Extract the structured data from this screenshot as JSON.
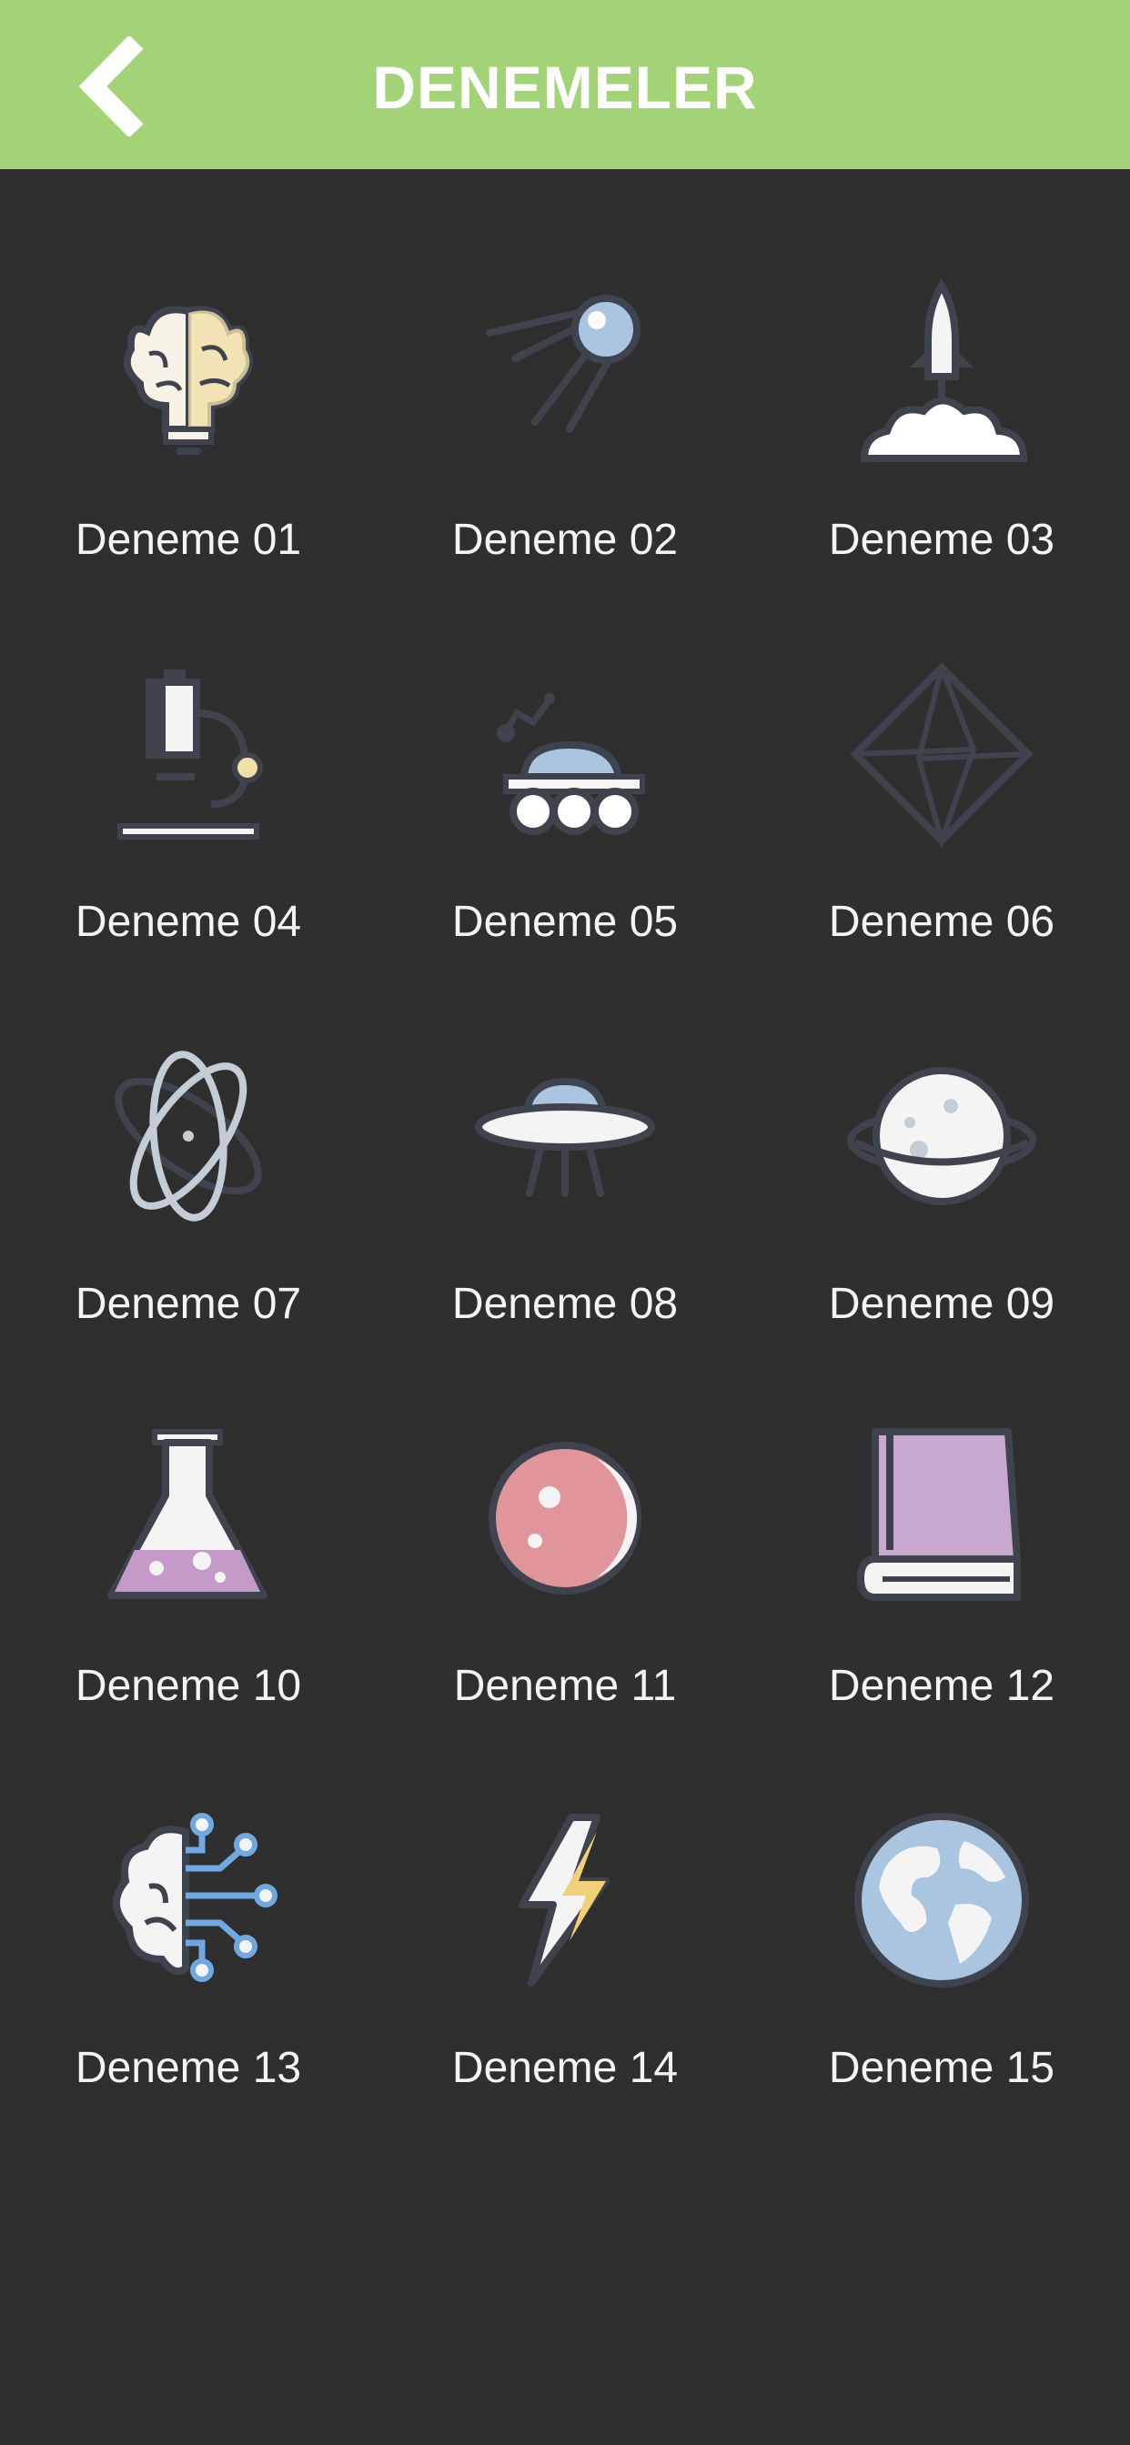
{
  "header": {
    "title": "DENEMELER",
    "back_icon": "chevron-left-icon"
  },
  "colors": {
    "header_bg": "#a3d377",
    "background": "#2f2f2f",
    "text": "#ffffff",
    "icon_outline": "#3f434d"
  },
  "items": [
    {
      "label": "Deneme 01",
      "icon": "brain-bulb-icon"
    },
    {
      "label": "Deneme 02",
      "icon": "satellite-icon"
    },
    {
      "label": "Deneme 03",
      "icon": "rocket-launch-icon"
    },
    {
      "label": "Deneme 04",
      "icon": "microscope-icon"
    },
    {
      "label": "Deneme 05",
      "icon": "moon-rover-icon"
    },
    {
      "label": "Deneme 06",
      "icon": "octahedron-icon"
    },
    {
      "label": "Deneme 07",
      "icon": "atom-icon"
    },
    {
      "label": "Deneme 08",
      "icon": "ufo-icon"
    },
    {
      "label": "Deneme 09",
      "icon": "planet-icon"
    },
    {
      "label": "Deneme 10",
      "icon": "flask-icon"
    },
    {
      "label": "Deneme 11",
      "icon": "mars-icon"
    },
    {
      "label": "Deneme 12",
      "icon": "book-icon"
    },
    {
      "label": "Deneme 13",
      "icon": "ai-brain-icon"
    },
    {
      "label": "Deneme 14",
      "icon": "lightning-icon"
    },
    {
      "label": "Deneme 15",
      "icon": "earth-globe-icon"
    }
  ]
}
